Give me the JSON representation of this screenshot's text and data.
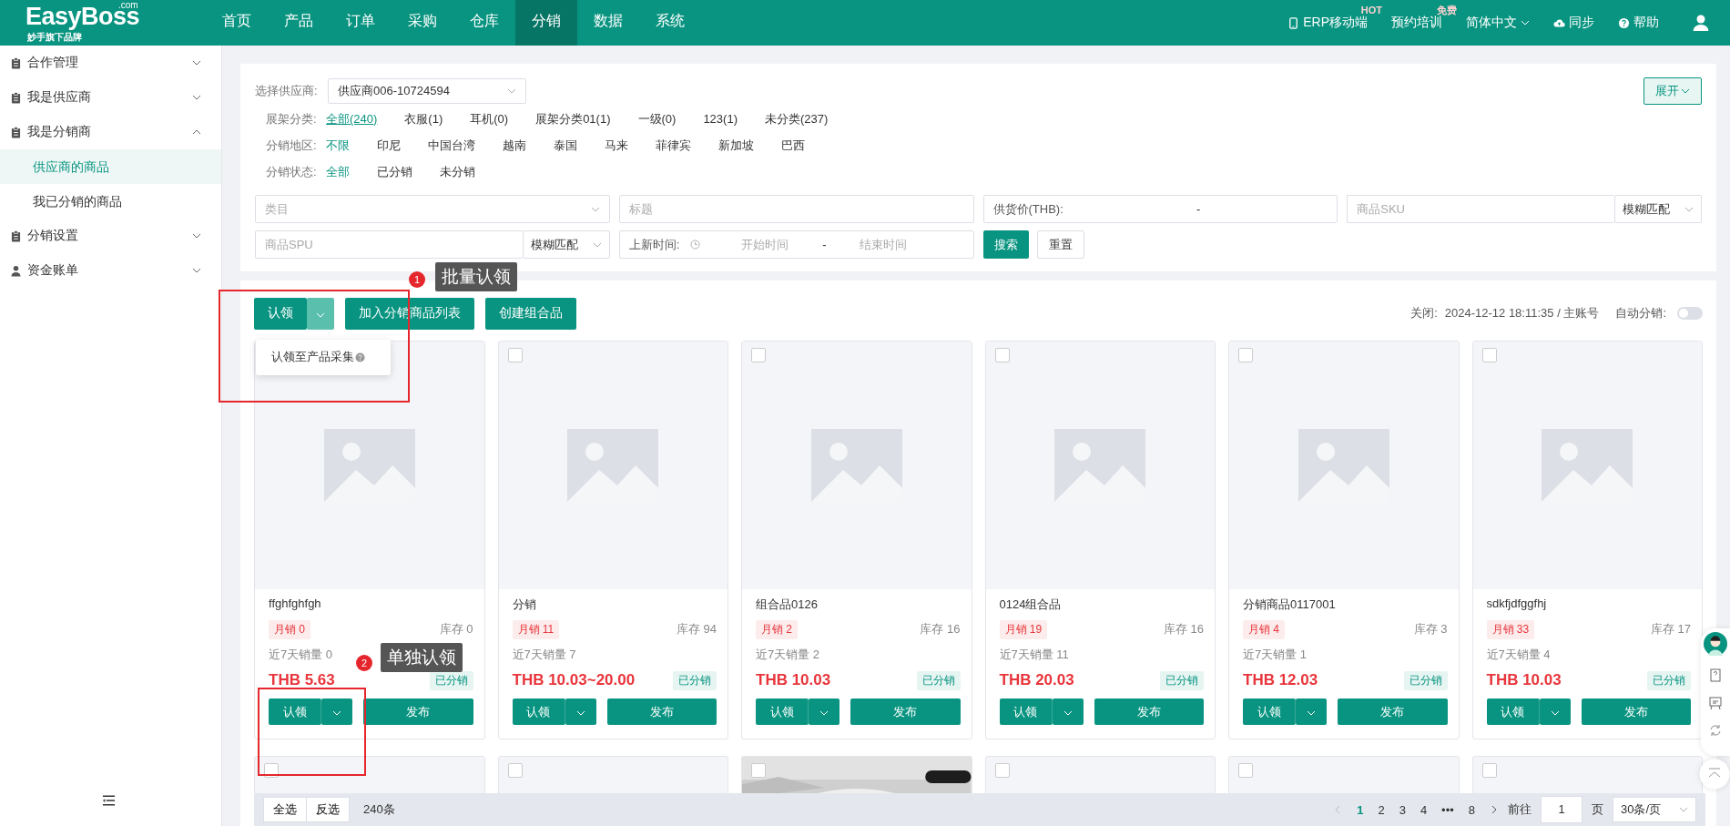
{
  "header": {
    "logo": "EasyBoss",
    "logo_sup": ".com",
    "logo_sub": "妙手旗下品牌",
    "nav": [
      {
        "label": "首页",
        "selected": false
      },
      {
        "label": "产品",
        "selected": false
      },
      {
        "label": "订单",
        "selected": false
      },
      {
        "label": "采购",
        "selected": false
      },
      {
        "label": "仓库",
        "selected": false
      },
      {
        "label": "分销",
        "selected": true
      },
      {
        "label": "数据",
        "selected": false
      },
      {
        "label": "系统",
        "selected": false
      }
    ],
    "tools": [
      {
        "kind": "phone",
        "label": "ERP移动端",
        "badge": "HOT"
      },
      {
        "kind": "plain",
        "label": "预约培训",
        "badge": "免费"
      },
      {
        "kind": "lang",
        "label": "简体中文"
      },
      {
        "kind": "cloud",
        "label": "同步"
      },
      {
        "kind": "help",
        "label": "帮助"
      }
    ]
  },
  "sidebar": {
    "items": [
      {
        "label": "合作管理",
        "kind": "doc",
        "expanded": false
      },
      {
        "label": "我是供应商",
        "kind": "doc",
        "expanded": false
      },
      {
        "label": "我是分销商",
        "kind": "doc",
        "expanded": true,
        "children": [
          {
            "label": "供应商的商品",
            "selected": true
          },
          {
            "label": "我已分销的商品",
            "selected": false
          }
        ]
      },
      {
        "label": "分销设置",
        "kind": "doc",
        "expanded": false
      },
      {
        "label": "资金账单",
        "kind": "user",
        "expanded": false
      }
    ]
  },
  "filters": {
    "supplier": {
      "label": "选择供应商:",
      "value": "供应商006-10724594"
    },
    "expand_button": "展开",
    "rows": [
      {
        "label": "展架分类:",
        "underline": true,
        "options": [
          {
            "label": "全部(240)",
            "selected": true
          },
          {
            "label": "衣服(1)",
            "selected": false
          },
          {
            "label": "耳机(0)",
            "selected": false
          },
          {
            "label": "展架分类01(1)",
            "selected": false
          },
          {
            "label": "一级(0)",
            "selected": false
          },
          {
            "label": "123(1)",
            "selected": false
          },
          {
            "label": "未分类(237)",
            "selected": false
          }
        ]
      },
      {
        "label": "分销地区:",
        "underline": false,
        "options": [
          {
            "label": "不限",
            "selected": true
          },
          {
            "label": "印尼",
            "selected": false
          },
          {
            "label": "中国台湾",
            "selected": false
          },
          {
            "label": "越南",
            "selected": false
          },
          {
            "label": "泰国",
            "selected": false
          },
          {
            "label": "马来",
            "selected": false
          },
          {
            "label": "菲律宾",
            "selected": false
          },
          {
            "label": "新加坡",
            "selected": false
          },
          {
            "label": "巴西",
            "selected": false
          }
        ]
      },
      {
        "label": "分销状态:",
        "underline": false,
        "options": [
          {
            "label": "全部",
            "selected": true
          },
          {
            "label": "已分销",
            "selected": false
          },
          {
            "label": "未分销",
            "selected": false
          }
        ]
      }
    ],
    "fields": [
      {
        "kind": "select",
        "placeholder": "类目"
      },
      {
        "kind": "input",
        "placeholder": "标题"
      },
      {
        "kind": "range",
        "label": "供货价(THB):",
        "separator": "-"
      },
      {
        "kind": "match",
        "placeholder": "商品SKU",
        "mode": "模糊匹配"
      },
      {
        "kind": "match",
        "placeholder": "商品SPU",
        "mode": "模糊匹配"
      },
      {
        "kind": "date",
        "label": "上新时间:",
        "start_placeholder": "开始时间",
        "separator": "-",
        "end_placeholder": "结束时间"
      }
    ],
    "search_button": "搜索",
    "reset_button": "重置"
  },
  "toolbar": {
    "claim_button": "认领",
    "buttons": [
      "加入分销商品列表",
      "创建组合品"
    ],
    "dropdown_item": "认领至产品采集",
    "status_label": "关闭:",
    "status_value": "2024-12-12 18:11:35 / 主账号",
    "auto_label": "自动分销:",
    "auto_on": false
  },
  "products": [
    {
      "title": "ffghfghfgh",
      "monthly": "月销 0",
      "stock": "库存 0",
      "week": "近7天销量 0",
      "price": "THB 5.63",
      "status": "已分销",
      "claim": "认领",
      "publish": "发布"
    },
    {
      "checked": false,
      "title": "分销",
      "monthly": "月销 11",
      "stock": "库存 94",
      "week": "近7天销量 7",
      "price": "THB 10.03~20.00",
      "status": "已分销",
      "claim": "认领",
      "publish": "发布"
    },
    {
      "checked": false,
      "title": "组合品0126",
      "monthly": "月销 2",
      "stock": "库存 16",
      "week": "近7天销量 2",
      "price": "THB 10.03",
      "status": "已分销",
      "claim": "认领",
      "publish": "发布"
    },
    {
      "checked": false,
      "title": "0124组合品",
      "monthly": "月销 19",
      "stock": "库存 16",
      "week": "近7天销量 11",
      "price": "THB 20.03",
      "status": "已分销",
      "claim": "认领",
      "publish": "发布"
    },
    {
      "checked": false,
      "title": "分销商品0117001",
      "monthly": "月销 4",
      "stock": "库存 3",
      "week": "近7天销量 1",
      "price": "THB 12.03",
      "status": "已分销",
      "claim": "认领",
      "publish": "发布"
    },
    {
      "checked": false,
      "title": "sdkfjdfggfhj",
      "monthly": "月销 33",
      "stock": "库存 17",
      "week": "近7天销量 4",
      "price": "THB 10.03",
      "status": "已分销",
      "claim": "认领",
      "publish": "发布"
    }
  ],
  "products_row2": [
    {
      "kind": "placeholder",
      "checked": false
    },
    {
      "kind": "placeholder",
      "checked": false
    },
    {
      "kind": "picture",
      "checked": false
    },
    {
      "kind": "placeholder",
      "checked": false
    },
    {
      "kind": "placeholder",
      "checked": false
    },
    {
      "kind": "placeholder",
      "checked": false
    }
  ],
  "pagination": {
    "select_all": "全选",
    "invert": "反选",
    "total": "240条",
    "pages": [
      {
        "label": "1",
        "selected": true
      },
      {
        "label": "2",
        "selected": false
      },
      {
        "label": "3",
        "selected": false
      },
      {
        "label": "4",
        "selected": false
      },
      {
        "label": "•••",
        "selected": false
      },
      {
        "label": "8",
        "selected": false
      }
    ],
    "goto_label": "前往",
    "goto_value": "1",
    "page_unit": "页",
    "page_size": "30条/页"
  },
  "annotations": [
    {
      "number": "1",
      "text": "批量认领"
    },
    {
      "number": "2",
      "text": "单独认领"
    }
  ]
}
